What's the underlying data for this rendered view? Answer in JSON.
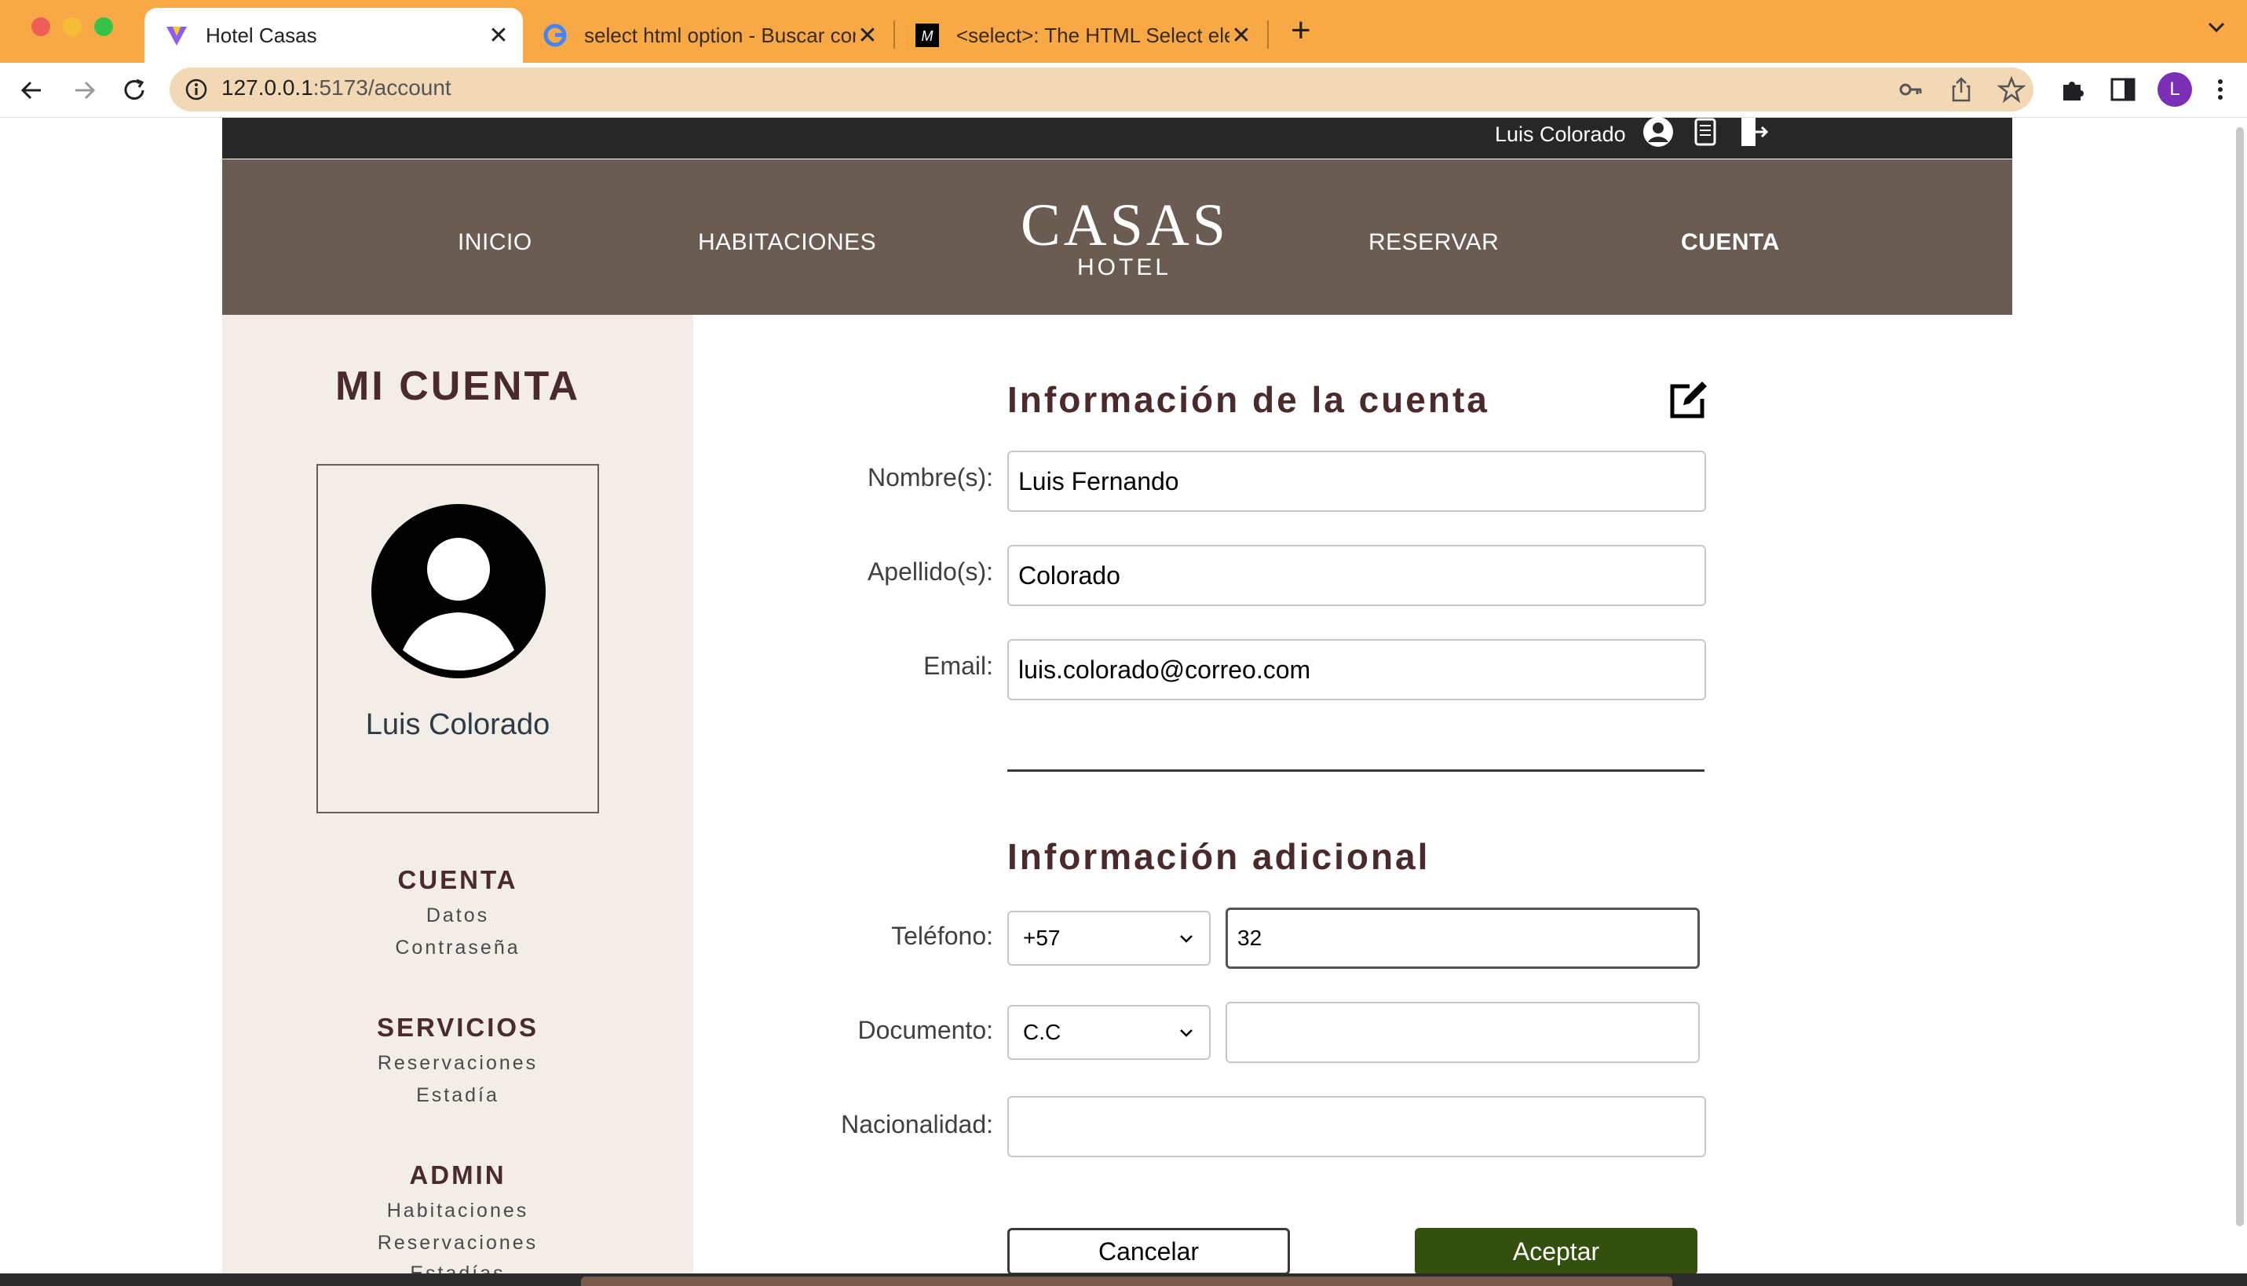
{
  "browser": {
    "tabs": [
      {
        "title": "Hotel Casas",
        "active": true
      },
      {
        "title": "select html option - Buscar con Google",
        "active": false
      },
      {
        "title": "<select>: The HTML Select element",
        "active": false
      }
    ],
    "url_host": "127.0.0.1",
    "url_rest": ":5173/account",
    "profile_letter": "L"
  },
  "topbar": {
    "username": "Luis Colorado"
  },
  "nav": {
    "items": [
      "INICIO",
      "HABITACIONES",
      "RESERVAR",
      "CUENTA"
    ],
    "logo_main": "CASAS",
    "logo_sub": "HOTEL"
  },
  "sidebar": {
    "title": "MI CUENTA",
    "profile_name": "Luis Colorado",
    "sections": [
      {
        "title": "CUENTA",
        "items": [
          "Datos",
          "Contraseña"
        ]
      },
      {
        "title": "SERVICIOS",
        "items": [
          "Reservaciones",
          "Estadía"
        ]
      },
      {
        "title": "ADMIN",
        "items": [
          "Habitaciones",
          "Reservaciones",
          "Estadías"
        ]
      }
    ]
  },
  "account": {
    "title": "Información de la cuenta",
    "fields": [
      {
        "label": "Nombre(s):",
        "value": "Luis Fernando"
      },
      {
        "label": "Apellido(s):",
        "value": "Colorado"
      },
      {
        "label": "Email:",
        "value": "luis.colorado@correo.com"
      }
    ]
  },
  "additional": {
    "title": "Información adicional",
    "phone": {
      "label": "Teléfono:",
      "code": "+57",
      "value": "32"
    },
    "document": {
      "label": "Documento:",
      "type": "C.C",
      "value": ""
    },
    "nationality": {
      "label": "Nacionalidad:",
      "value": ""
    }
  },
  "buttons": {
    "cancel": "Cancelar",
    "accept": "Aceptar"
  },
  "colors": {
    "accent": "#4a2a2a",
    "header": "#6a5b53",
    "accept": "#33500e",
    "tabbar": "#f8a845"
  }
}
